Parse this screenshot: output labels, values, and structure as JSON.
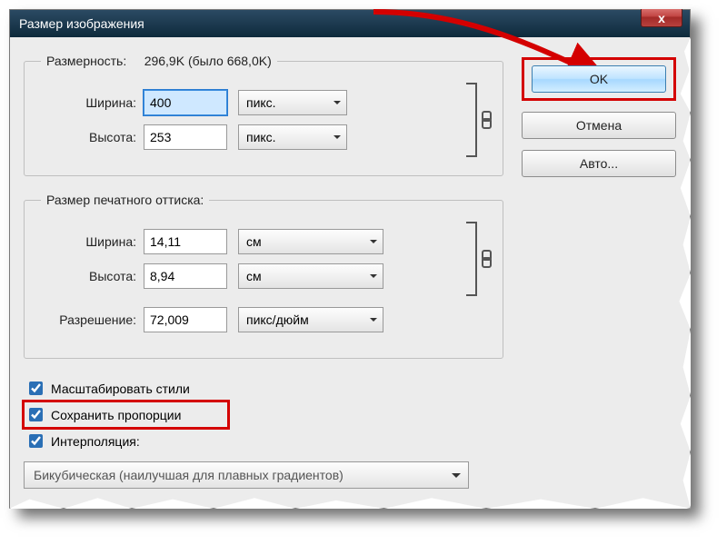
{
  "window": {
    "title": "Размер изображения"
  },
  "dimensions": {
    "legend_prefix": "Размерность:",
    "summary": "296,9K (было 668,0K)",
    "width_label": "Ширина:",
    "width_value": "400",
    "width_unit": "пикс.",
    "height_label": "Высота:",
    "height_value": "253",
    "height_unit": "пикс."
  },
  "print": {
    "legend": "Размер печатного оттиска:",
    "width_label": "Ширина:",
    "width_value": "14,11",
    "width_unit": "см",
    "height_label": "Высота:",
    "height_value": "8,94",
    "height_unit": "см",
    "res_label": "Разрешение:",
    "res_value": "72,009",
    "res_unit": "пикс/дюйм"
  },
  "options": {
    "scale_styles": "Масштабировать стили",
    "constrain": "Сохранить пропорции",
    "resample": "Интерполяция:",
    "method": "Бикубическая (наилучшая для плавных градиентов)"
  },
  "buttons": {
    "ok": "OK",
    "cancel": "Отмена",
    "auto": "Авто..."
  },
  "icons": {
    "close_glyph": "x"
  }
}
